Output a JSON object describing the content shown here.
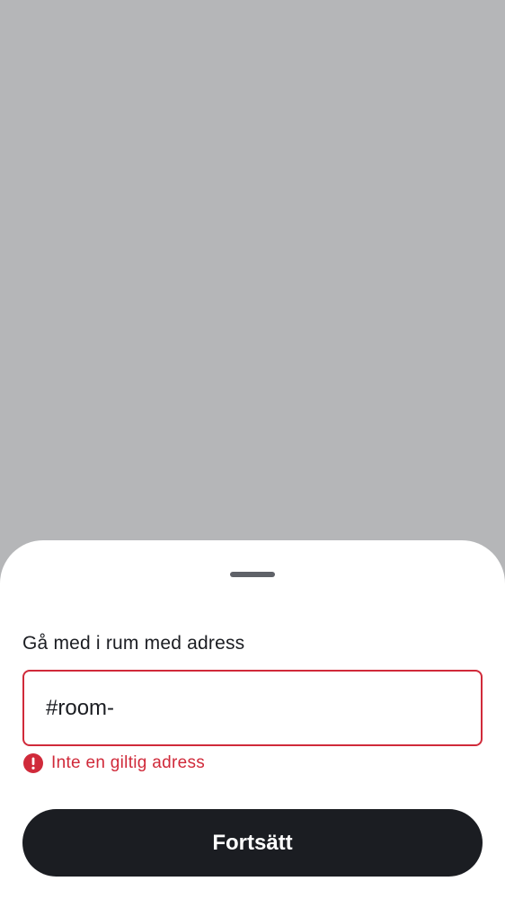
{
  "sheet": {
    "label": "Gå med i rum med adress",
    "address_input": {
      "value": "#room-",
      "placeholder": ""
    },
    "error": {
      "icon": "error-icon",
      "text": "Inte en giltig adress"
    },
    "continue_button": {
      "label": "Fortsätt"
    }
  },
  "colors": {
    "backdrop": "#b5b6b8",
    "sheet": "#ffffff",
    "error": "#d02a3a",
    "button": "#1b1d22",
    "text": "#1b1d22",
    "handle": "#5f6268"
  }
}
